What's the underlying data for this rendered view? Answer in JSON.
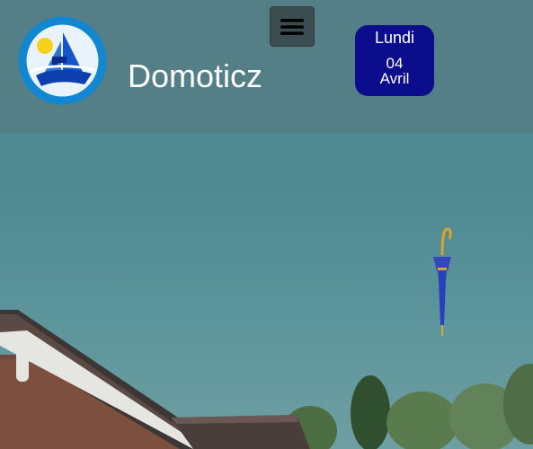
{
  "header": {
    "title": "Domoticz",
    "logo_icon": "domoticz-sailboat-logo-icon",
    "menu_icon": "hamburger-menu-icon"
  },
  "date_widget": {
    "day": "Lundi",
    "date": "04",
    "month": "Avril"
  },
  "weather_icon": "umbrella-icon",
  "colors": {
    "header_band": "#547f87",
    "date_box": "#0c0d8c",
    "menu_button": "#3b4d50",
    "title_text": "#ffffff"
  }
}
